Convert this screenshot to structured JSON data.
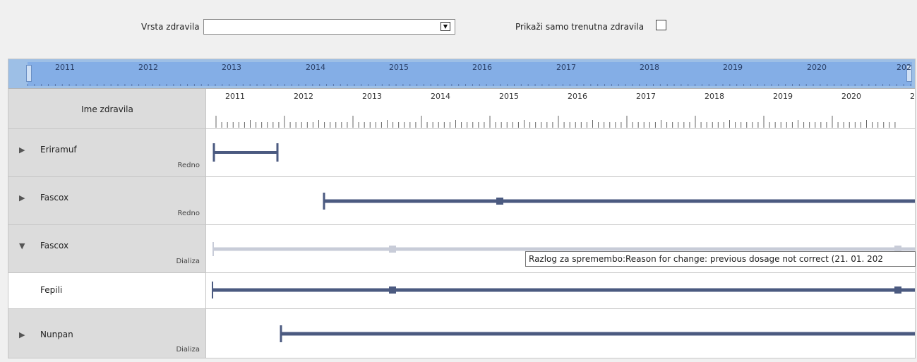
{
  "filter": {
    "type_label": "Vrsta zdravila",
    "type_value": "",
    "current_only_label": "Prikaži samo trenutna zdravila",
    "current_only_checked": false
  },
  "overview": {
    "years": [
      "2011",
      "2012",
      "2013",
      "2014",
      "2015",
      "2016",
      "2017",
      "2018",
      "2019",
      "2020",
      "202"
    ]
  },
  "timeline_header": {
    "column_title": "Ime zdravila",
    "years": [
      "2011",
      "2012",
      "2013",
      "2014",
      "2015",
      "2016",
      "2017",
      "2018",
      "2019",
      "2020",
      "2("
    ]
  },
  "rows": [
    {
      "expander": "▶",
      "name": "Eriramuf",
      "type": "Redno"
    },
    {
      "expander": "▶",
      "name": "Fascox",
      "type": "Redno"
    },
    {
      "expander": "▼",
      "name": "Fascox",
      "type": "Dializa"
    },
    {
      "expander": "",
      "name": "Fepili",
      "type": ""
    },
    {
      "expander": "▶",
      "name": "Nunpan",
      "type": "Dializa"
    }
  ],
  "tooltip": {
    "text": "Razlog za spremembo:Reason for change: previous dosage not correct (21. 01. 202"
  },
  "colors": {
    "bar": "#4b5a80",
    "bar_faded": "#c8ccd8",
    "overview_selection": "#84aee6"
  }
}
